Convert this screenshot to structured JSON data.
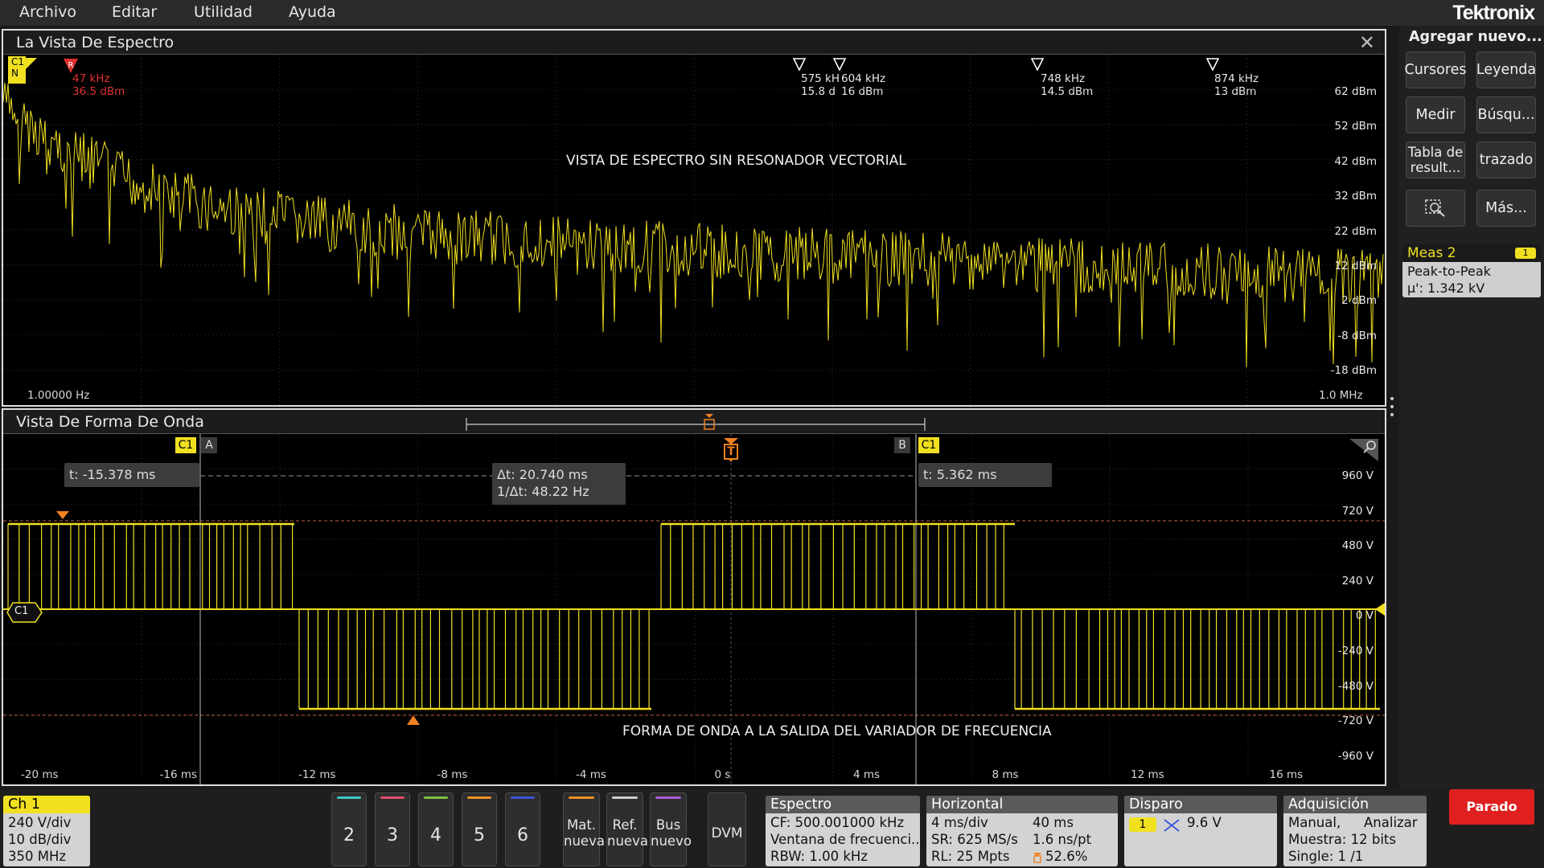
{
  "menu": {
    "items": [
      "Archivo",
      "Editar",
      "Utilidad",
      "Ayuda"
    ],
    "brand": "Tektronix"
  },
  "spectrum": {
    "title": "La Vista De Espectro",
    "channel_tag": "C1",
    "channel_tag_sub": "N",
    "ref_marker": {
      "label": "R",
      "freq": "47 kHz",
      "level": "36.5 dBm"
    },
    "peak_markers": [
      {
        "freq": "575 kH",
        "level": "15.8 d"
      },
      {
        "freq": "604 kHz",
        "level": "16 dBm"
      },
      {
        "freq": "748 kHz",
        "level": "14.5 dBm"
      },
      {
        "freq": "874 kHz",
        "level": "13 dBm"
      }
    ],
    "y_ticks": [
      "62 dBm",
      "52 dBm",
      "42 dBm",
      "32 dBm",
      "22 dBm",
      "12 dBm",
      "2 dBm",
      "-8 dBm",
      "-18 dBm"
    ],
    "x_start": "1.00000 Hz",
    "x_end": "1.0 MHz",
    "annotation": "VISTA DE ESPECTRO SIN RESONADOR VECTORIAL"
  },
  "waveform": {
    "title": "Vista De Forma De Onda",
    "cursor_a": {
      "tag": "C1",
      "label": "A",
      "readout": "t: -15.378 ms"
    },
    "cursor_b": {
      "tag": "C1",
      "label": "B",
      "readout": "t: 5.362 ms"
    },
    "delta": {
      "dt": "Δt: 20.740 ms",
      "inv": "1/Δt: 48.22 Hz"
    },
    "trigger_tag": "T",
    "channel_marker": "C1",
    "y_ticks": [
      "960 V",
      "720 V",
      "480 V",
      "240 V",
      "0 V",
      "-240 V",
      "-480 V",
      "-720 V",
      "-960 V"
    ],
    "x_ticks": [
      "-20 ms",
      "-16 ms",
      "-12 ms",
      "-8 ms",
      "-4 ms",
      "0 s",
      "4 ms",
      "8 ms",
      "12 ms",
      "16 ms"
    ],
    "annotation": "FORMA DE ONDA A LA SALIDA DEL VARIADOR DE FRECUENCIA"
  },
  "sidebar": {
    "header": "Agregar nuevo...",
    "buttons": [
      "Cursores",
      "Leyenda",
      "Medir",
      "Búsqu...",
      "Tabla de result...",
      "trazado",
      "Más..."
    ],
    "meas": {
      "title": "Meas 2",
      "badge": "1",
      "name": "Peak-to-Peak",
      "value": "μ': 1.342 kV"
    }
  },
  "bottom": {
    "ch1": {
      "title": "Ch 1",
      "lines": [
        "240 V/div",
        "10 dB/div",
        "350 MHz"
      ]
    },
    "channels": [
      {
        "num": "2",
        "color": "#3fc7c7"
      },
      {
        "num": "3",
        "color": "#e0506a"
      },
      {
        "num": "4",
        "color": "#7fc23f"
      },
      {
        "num": "5",
        "color": "#f0902a"
      },
      {
        "num": "6",
        "color": "#3a55d8"
      }
    ],
    "add_buttons": [
      {
        "label": "Mat. nueva",
        "color": "#f0902a"
      },
      {
        "label": "Ref. nueva",
        "color": "#cfcfcf"
      },
      {
        "label": "Bus nuevo",
        "color": "#b05ad8"
      }
    ],
    "dvm": "DVM",
    "spectrum": {
      "title": "Espectro",
      "cf": "CF: 500.001000 kHz",
      "win": "Ventana de frecuenci...",
      "rbw": "RBW: 1.00 kHz"
    },
    "horizontal": {
      "title": "Horizontal",
      "div": "4 ms/div",
      "len": "40 ms",
      "sr": "SR: 625 MS/s",
      "res": "1.6 ns/pt",
      "rl": "RL: 25 Mpts",
      "pos": "52.6%"
    },
    "trigger": {
      "title": "Disparo",
      "src": "1",
      "level": "9.6 V"
    },
    "acq": {
      "title": "Adquisición",
      "mode": "Manual,",
      "analyze": "Analizar",
      "sample": "Muestra: 12 bits",
      "single": "Single: 1 /1"
    },
    "run_state": "Parado"
  },
  "colors": {
    "trace": "#f0e020",
    "ref": "#e03030",
    "trigger": "#f08020",
    "run": "#e02020"
  }
}
